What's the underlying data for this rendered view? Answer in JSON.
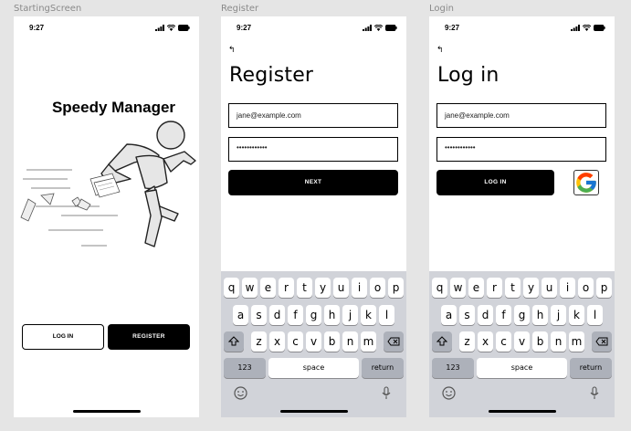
{
  "frames": {
    "starting": {
      "label": "StartingScreen",
      "time": "9:27",
      "app_title": "Speedy Manager",
      "login_label": "LOG IN",
      "register_label": "REGISTER"
    },
    "register": {
      "label": "Register",
      "time": "9:27",
      "back": "↰",
      "heading": "Register",
      "email_value": "jane@example.com",
      "password_value": "••••••••••••",
      "next_label": "NEXT"
    },
    "login": {
      "label": "Login",
      "time": "9:27",
      "back": "↰",
      "heading": "Log in",
      "email_value": "jane@example.com",
      "password_value": "••••••••••••",
      "login_label": "LOG IN",
      "google_icon": "google-g-icon"
    }
  },
  "keyboard": {
    "row1": [
      "q",
      "w",
      "e",
      "r",
      "t",
      "y",
      "u",
      "i",
      "o",
      "p"
    ],
    "row2": [
      "a",
      "s",
      "d",
      "f",
      "g",
      "h",
      "j",
      "k",
      "l"
    ],
    "row3": [
      "z",
      "x",
      "c",
      "v",
      "b",
      "n",
      "m"
    ],
    "numbers_label": "123",
    "space_label": "space",
    "return_label": "return"
  },
  "colors": {
    "background": "#e5e5e5",
    "button_primary": "#000000",
    "keyboard_bg": "#d1d3d9",
    "google_blue": "#4285F4",
    "google_red": "#EA4335",
    "google_yellow": "#FBBC05",
    "google_green": "#34A853"
  }
}
